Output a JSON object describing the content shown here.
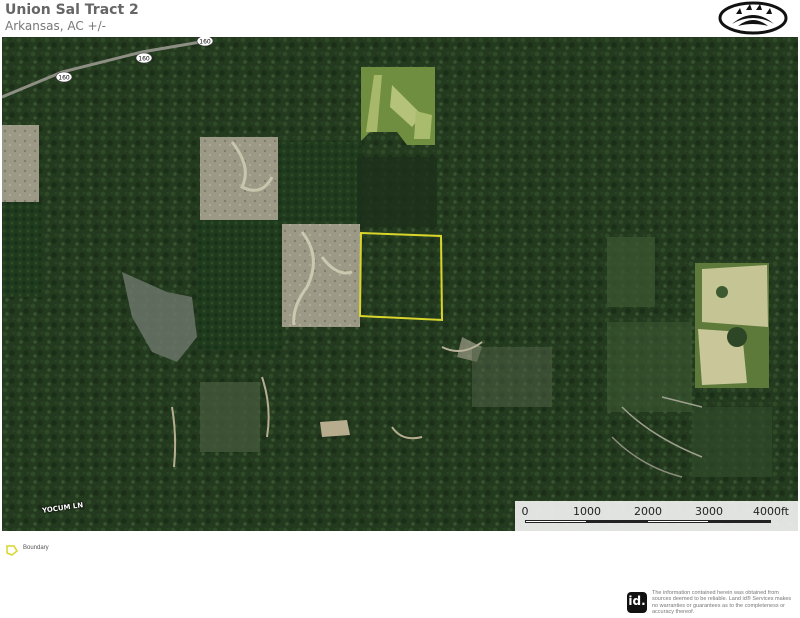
{
  "header": {
    "title": "Union Sal Tract 2",
    "subtitle": "Arkansas,  AC +/-"
  },
  "map": {
    "road_labels": [
      {
        "text": "YOCUM LN"
      }
    ],
    "highway_shields": [
      "160",
      "160",
      "160"
    ],
    "boundary_color": "#d9d52a"
  },
  "scale": {
    "labels": [
      "0",
      "1000",
      "2000",
      "3000",
      "4000ft"
    ]
  },
  "legend": {
    "boundary_label": "Boundary"
  },
  "footer": {
    "logo_text": "id.",
    "disclaimer": "The information contained herein was obtained from sources deemed to be reliable. Land id® Services makes no warranties or guarantees as to the completeness or accuracy thereof."
  }
}
